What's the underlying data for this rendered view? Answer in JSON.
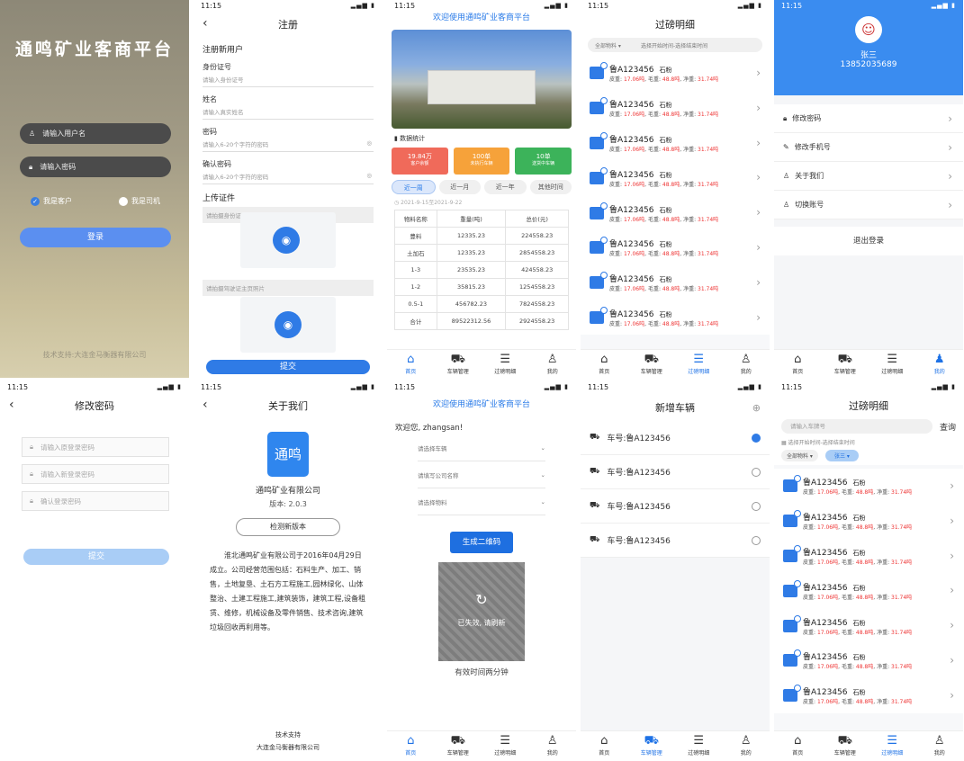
{
  "status_time": "11:15",
  "login": {
    "title": "通鸣矿业客商平台",
    "user_ph": "请输入用户名",
    "pwd_ph": "请输入密码",
    "opt_customer": "我是客户",
    "opt_driver": "我是司机",
    "btn": "登录",
    "footer": "技术支持:大连金马衡器有限公司"
  },
  "register": {
    "title": "注册",
    "section": "注册新用户",
    "id_lab": "身份证号",
    "id_ph": "请输入身份证号",
    "name_lab": "姓名",
    "name_ph": "请输入真实姓名",
    "pwd_lab": "密码",
    "pwd_ph": "请输入6-20个字符的密码",
    "cpwd_lab": "确认密码",
    "cpwd_ph": "请输入6-20个字符的密码",
    "upload": "上传证件",
    "id_front": "请拍摄身份证正面信息",
    "id_hold": "请拍摄驾驶证主页照片",
    "submit": "提交"
  },
  "home": {
    "welcome": "欢迎使用通鸣矿业客商平台",
    "stats_title": "数据统计",
    "stats": [
      {
        "v": "19.84万",
        "l": "客户余额"
      },
      {
        "v": "100单",
        "l": "未执行车辆"
      },
      {
        "v": "10单",
        "l": "送货中车辆"
      }
    ],
    "periods": [
      "近一周",
      "近一月",
      "近一年",
      "其他时间"
    ],
    "range": "2021-9-15至2021-9-22",
    "table_head": [
      "物料名称",
      "重量(吨)",
      "总价(元)"
    ],
    "rows": [
      [
        "豊料",
        "12335.23",
        "224558.23"
      ],
      [
        "土加石",
        "12335.23",
        "2854558.23"
      ],
      [
        "1-3",
        "23535.23",
        "424558.23"
      ],
      [
        "1-2",
        "35815.23",
        "1254558.23"
      ],
      [
        "0.5-1",
        "456782.23",
        "7824558.23"
      ],
      [
        "合计",
        "89522312.56",
        "2924558.23"
      ]
    ]
  },
  "tabs": [
    "首页",
    "车辆管理",
    "过磅明细",
    "我的"
  ],
  "records": {
    "title": "过磅明细",
    "filter_material": "全部物料",
    "filter_time": "选择开始时间-选择结束时间",
    "plate": "鲁A123456",
    "material": "石粉",
    "l2a": "皮重: ",
    "tare": "17.06吨",
    "l2b": ",  毛重: ",
    "gross": "48.8吨",
    "l2c": ",  净重: ",
    "net": "31.74吨"
  },
  "profile": {
    "name": "张三",
    "phone": "13852035689",
    "items": [
      "修改密码",
      "修改手机号",
      "关于我们",
      "切换账号"
    ],
    "logout": "退出登录"
  },
  "pwd": {
    "title": "修改密码",
    "old": "请输入原登录密码",
    "new": "请输入新登录密码",
    "confirm": "确认登录密码",
    "submit": "提交"
  },
  "about": {
    "title": "关于我们",
    "logo": "通鸣",
    "company": "通鸣矿业有限公司",
    "version": "版本: 2.0.3",
    "check": "检测新版本",
    "desc": "淮北通鸣矿业有限公司于2016年04月29日成立。公司经营范围包括：石料生产、加工、销售，土地复垦、土石方工程施工,园林绿化、山体整治、土建工程施工,建筑装饰，建筑工程,设备租赁、维修，机械设备及零件销售、技术咨询,建筑垃圾回收再利用等。",
    "support": "技术支持",
    "support_co": "大连金马衡器有限公司"
  },
  "qr": {
    "welcome": "欢迎使用通鸣矿业客商平台",
    "hello": "欢迎您, zhangsan!",
    "sel1": "请选择车辆",
    "sel2": "请填写公司名称",
    "sel3": "请选择物料",
    "btn": "生成二维码",
    "expired": "已失效, 请刷新",
    "valid": "有效时间两分钟"
  },
  "vehicles": {
    "title": "新增车辆",
    "item": "车号:鲁A123456"
  },
  "records2": {
    "title": "过磅明细",
    "search_ph": "请输入车牌号",
    "search": "查询",
    "time": "选择开始时间-选择结束时间",
    "material": "全部物料",
    "chip": "张三"
  }
}
